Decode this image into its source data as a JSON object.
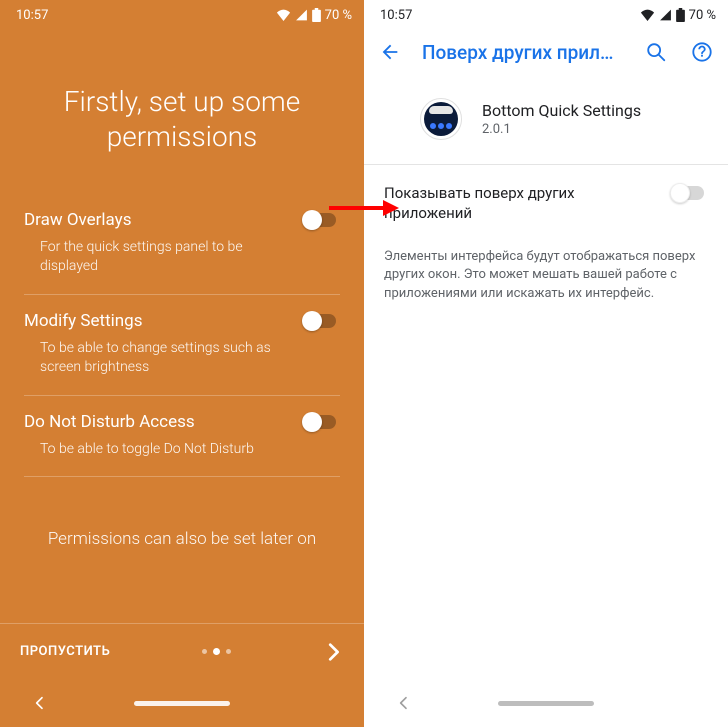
{
  "status": {
    "time": "10:57",
    "battery_label": "70 %"
  },
  "left": {
    "title": "Firstly, set up some permissions",
    "permissions": [
      {
        "label": "Draw Overlays",
        "desc": "For the quick settings panel to be displayed"
      },
      {
        "label": "Modify Settings",
        "desc": "To be able to change settings such as screen brightness"
      },
      {
        "label": "Do Not Disturb Access",
        "desc": "To be able to toggle Do Not Disturb"
      }
    ],
    "later_note": "Permissions can also be set later on",
    "skip_label": "ПРОПУСТИТЬ"
  },
  "right": {
    "title": "Поверх других прило…",
    "app_name": "Bottom Quick Settings",
    "app_version": "2.0.1",
    "toggle_label": "Показывать поверх других приложений",
    "toggle_desc": "Элементы интерфейса будут отображаться поверх других окон. Это может мешать вашей работе с приложениями или искажать их интерфейс."
  }
}
